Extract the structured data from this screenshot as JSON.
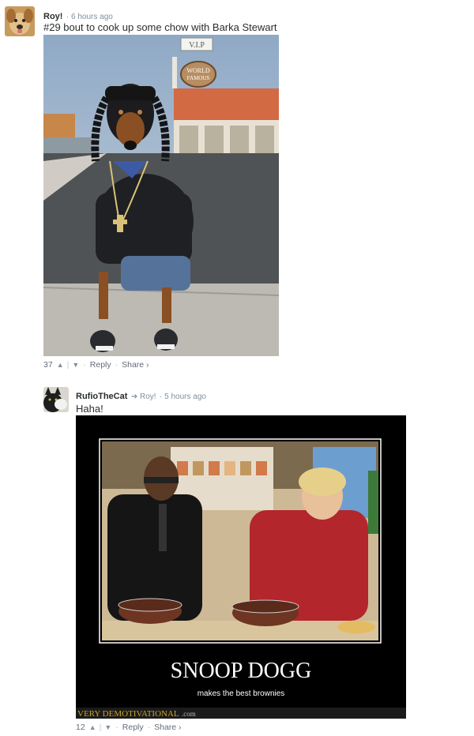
{
  "comments": [
    {
      "author": "Roy!",
      "time": "6 hours ago",
      "text": "#29 bout to cook up some chow with Barka Stewart",
      "votes": "37",
      "reply_label": "Reply",
      "share_label": "Share ›",
      "image": {
        "sign_vip": "V.I.P",
        "sign_world": "WORLD",
        "sign_famous": "FAMOUS"
      }
    },
    {
      "author": "RufioTheCat",
      "reply_to": "Roy!",
      "time": "5 hours ago",
      "text": "Haha!",
      "votes": "12",
      "reply_label": "Reply",
      "share_label": "Share ›",
      "image": {
        "headline": "SNOOP DOGG",
        "caption": "makes the best brownies",
        "watermark": "VERY DEMOTIVATIONAL",
        "watermark_suffix": ".com"
      }
    }
  ],
  "icons": {
    "upvote": "caret-up-icon",
    "downvote": "caret-down-icon",
    "reply_arrow": "reply-arrow-icon"
  },
  "colors": {
    "meta": "#7f919e",
    "text": "#2a2e2e",
    "poster_bg": "#000000",
    "watermark": "#c9a227"
  }
}
